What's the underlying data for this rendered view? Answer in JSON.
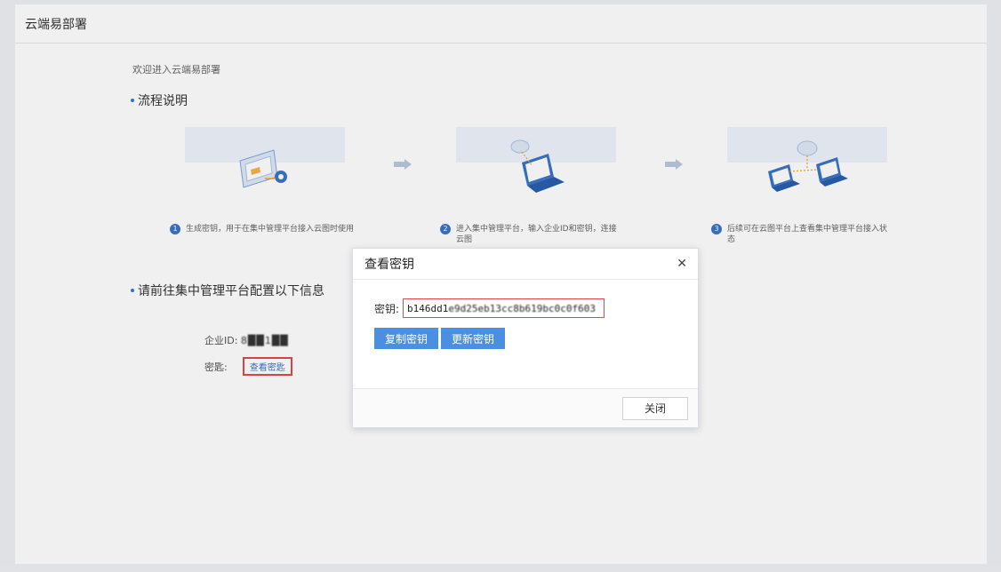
{
  "header": {
    "title": "云端易部署"
  },
  "main": {
    "welcome": "欢迎进入云端易部署",
    "section1_title": "流程说明",
    "section2_title": "请前往集中管理平台配置以下信息",
    "steps": [
      {
        "num": "1",
        "text": "生成密钥，用于在集中管理平台接入云图时使用"
      },
      {
        "num": "2",
        "text": "进入集中管理平台，输入企业ID和密钥，连接云图"
      },
      {
        "num": "3",
        "text": "后续可在云图平台上查看集中管理平台接入状态"
      }
    ],
    "enterprise_id_label": "企业ID:",
    "enterprise_id_value": "8██1██",
    "key_label": "密匙:",
    "view_key_link": "查看密匙"
  },
  "modal": {
    "title": "查看密钥",
    "close_icon": "close-icon",
    "key_label": "密钥:",
    "key_value_visible": "b146dd1",
    "key_value_masked": "e9d25eb13cc8b619bc0c0f603",
    "copy_button": "复制密钥",
    "update_button": "更新密钥",
    "close_button": "关闭"
  },
  "colors": {
    "primary": "#4a8fe0",
    "highlight_border": "#e0494a",
    "step_number": "#3a74c8"
  }
}
